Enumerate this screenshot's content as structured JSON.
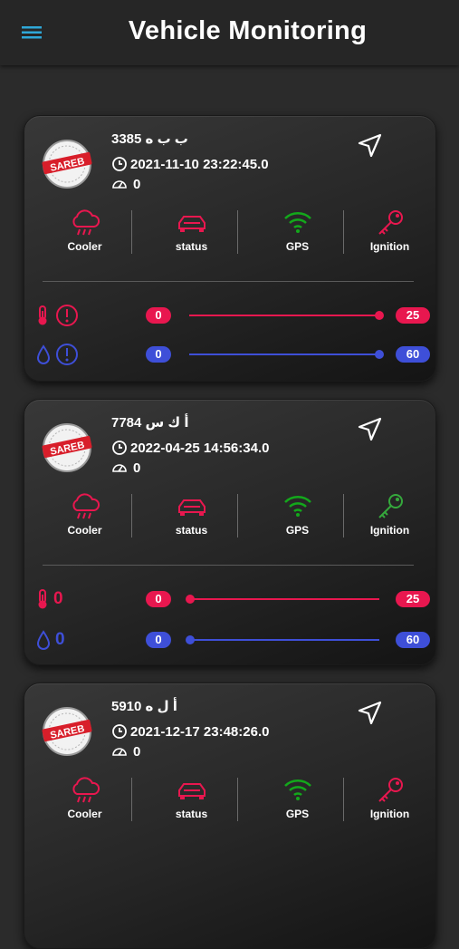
{
  "app": {
    "title": "Vehicle Monitoring"
  },
  "colors": {
    "accent_red": "#e8174f",
    "accent_blue": "#3e4fd8",
    "gps_green": "#13a81b",
    "ignition_green": "#35a83c"
  },
  "status_labels": {
    "cooler": "Cooler",
    "status": "status",
    "gps": "GPS",
    "ignition": "Ignition"
  },
  "vehicles": [
    {
      "plate": "ب ب ه 3385",
      "datetime": "2021-11-10 23:22:45.0",
      "speed": "0",
      "ignition_color": "#e8174f",
      "temp": {
        "alert": true,
        "value": "",
        "min": "0",
        "max": "25",
        "level": 1.0
      },
      "humidity": {
        "alert": true,
        "value": "",
        "min": "0",
        "max": "60",
        "level": 1.0
      }
    },
    {
      "plate": "أ ك س 7784",
      "datetime": "2022-04-25 14:56:34.0",
      "speed": "0",
      "ignition_color": "#35a83c",
      "temp": {
        "alert": false,
        "value": "0",
        "min": "0",
        "max": "25",
        "level": 0.0
      },
      "humidity": {
        "alert": false,
        "value": "0",
        "min": "0",
        "max": "60",
        "level": 0.0
      }
    },
    {
      "plate": "أ ل ه 5910",
      "datetime": "2021-12-17 23:48:26.0",
      "speed": "0",
      "ignition_color": "#e8174f"
    }
  ]
}
